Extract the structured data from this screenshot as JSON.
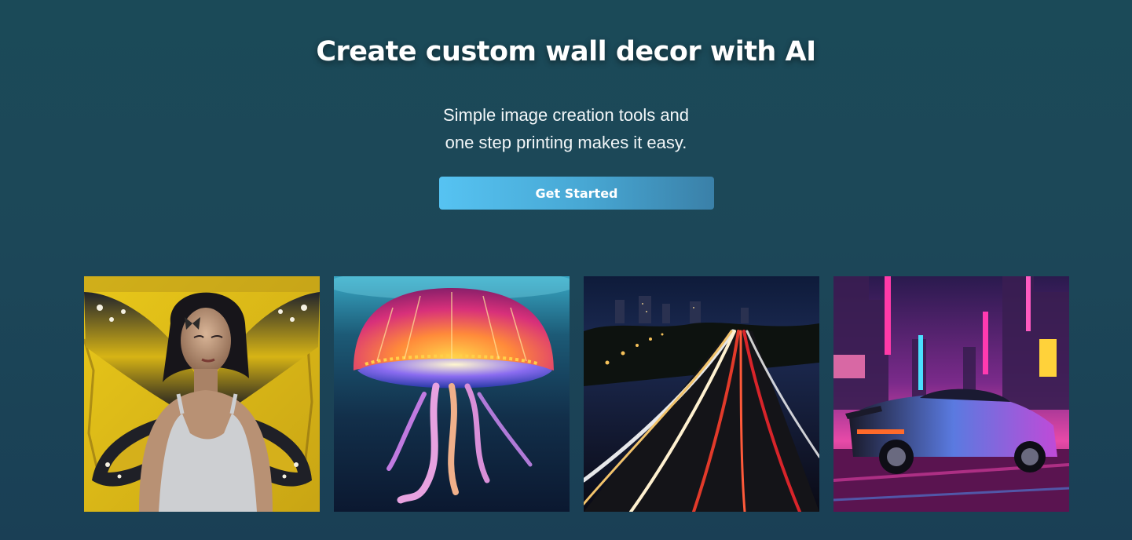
{
  "hero": {
    "title": "Create custom wall decor with AI",
    "subtitle_line1": "Simple image creation tools and",
    "subtitle_line2": "one step printing makes it easy.",
    "cta_label": "Get Started"
  },
  "gallery": {
    "images": [
      {
        "name": "butterfly-woman-image",
        "subject": "woman with butterfly wings on yellow wall"
      },
      {
        "name": "jellyfish-image",
        "subject": "glowing jellyfish underwater"
      },
      {
        "name": "highway-light-trails-image",
        "subject": "night highway with light trails"
      },
      {
        "name": "neon-sports-car-image",
        "subject": "sports car in neon city street"
      }
    ]
  },
  "colors": {
    "background_top": "#1b4a58",
    "background_bottom": "#1a3f55",
    "button_start": "#56c3f2",
    "button_end": "#3a80a8"
  }
}
